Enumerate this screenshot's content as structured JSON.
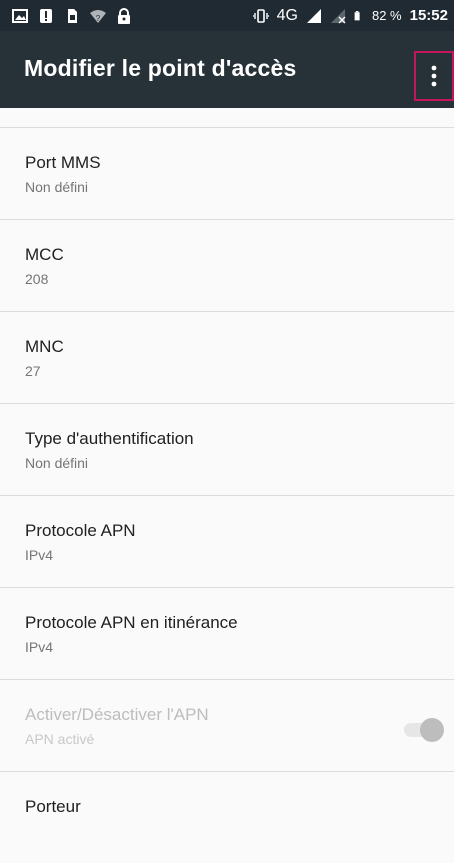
{
  "status_bar": {
    "icons_left": [
      "image-icon",
      "alert-icon",
      "sim-icon",
      "wifi-question-icon",
      "lock-icon"
    ],
    "vibrate_icon": "vibrate-icon",
    "network": "4G",
    "signal_icons": [
      "signal-roaming-icon",
      "signal-empty-icon"
    ],
    "battery_icon": "battery-icon",
    "battery_percent": "82 %",
    "time": "15:52"
  },
  "toolbar": {
    "title": "Modifier le point d'accès",
    "overflow_icon": "more-vertical-icon"
  },
  "items": [
    {
      "title": "Port MMS",
      "summary": "Non défini"
    },
    {
      "title": "MCC",
      "summary": "208"
    },
    {
      "title": "MNC",
      "summary": "27"
    },
    {
      "title": "Type d'authentification",
      "summary": "Non défini"
    },
    {
      "title": "Protocole APN",
      "summary": "IPv4"
    },
    {
      "title": "Protocole APN en itinérance",
      "summary": "IPv4"
    },
    {
      "title": "Activer/Désactiver l'APN",
      "summary": "APN activé",
      "toggle": true,
      "enabled": false
    },
    {
      "title": "Porteur"
    }
  ],
  "colors": {
    "status_bar_bg": "#1f2a33",
    "toolbar_bg": "#263238",
    "highlight": "#c2185b"
  }
}
